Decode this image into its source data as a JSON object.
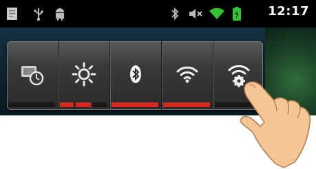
{
  "status_bar": {
    "time": "12:17",
    "left_icons": [
      "notes-icon",
      "usb-icon",
      "android-debug-icon"
    ],
    "right_icons": [
      "bluetooth-icon",
      "volume-muted-icon",
      "wifi-icon",
      "battery-icon"
    ]
  },
  "quick_settings": {
    "tiles": [
      {
        "name": "screen-timeout",
        "icon": "screen-timeout-icon",
        "levels": [
          0
        ]
      },
      {
        "name": "brightness",
        "icon": "brightness-icon",
        "levels": [
          1,
          1,
          0
        ]
      },
      {
        "name": "bluetooth",
        "icon": "bluetooth-icon",
        "levels": [
          1
        ]
      },
      {
        "name": "wifi",
        "icon": "wifi-icon",
        "levels": [
          1
        ]
      },
      {
        "name": "wifi-settings",
        "icon": "wifi-settings-icon",
        "levels": [
          0
        ]
      }
    ]
  },
  "colors": {
    "indicator_on": "#d7261f",
    "indicator_off": "#1a1a1a",
    "panel_bg": "#3a3a3a"
  }
}
